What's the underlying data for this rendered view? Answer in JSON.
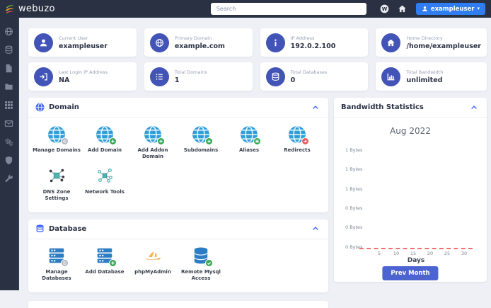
{
  "topbar": {
    "logo_text": "webuzo",
    "search": {
      "placeholder": "Search"
    },
    "user_button": {
      "label": "exampleuser"
    }
  },
  "sidebar": {
    "items": [
      {
        "id": "domains",
        "icon": "globe"
      },
      {
        "id": "databases",
        "icon": "database"
      },
      {
        "id": "files",
        "icon": "file"
      },
      {
        "id": "ftp",
        "icon": "folder"
      },
      {
        "id": "apps",
        "icon": "grid"
      },
      {
        "id": "email",
        "icon": "mail"
      },
      {
        "id": "services",
        "icon": "gears"
      },
      {
        "id": "security",
        "icon": "shield"
      },
      {
        "id": "tools",
        "icon": "wrench"
      }
    ]
  },
  "stats": {
    "cards": [
      {
        "icon": "user",
        "label": "Current User",
        "value": "exampleuser"
      },
      {
        "icon": "globe",
        "label": "Primary Domain",
        "value": "example.com"
      },
      {
        "icon": "info",
        "label": "IP Address",
        "value": "192.0.2.100"
      },
      {
        "icon": "home",
        "label": "Home Directory",
        "value": "/home/exampleuser"
      },
      {
        "icon": "signin",
        "label": "Last Login IP Address",
        "value": "NA"
      },
      {
        "icon": "list",
        "label": "Total Domains",
        "value": "1"
      },
      {
        "icon": "database",
        "label": "Total Databases",
        "value": "0"
      },
      {
        "icon": "chart",
        "label": "Total Bandwidth",
        "value": "unlimited"
      }
    ]
  },
  "panels": {
    "domain": {
      "title": "Domain",
      "items": [
        {
          "label": "Manage Domains",
          "icon": "globe-app",
          "badge": "gear"
        },
        {
          "label": "Add Domain",
          "icon": "globe-app",
          "badge": "plus"
        },
        {
          "label": "Add Addon Domain",
          "icon": "globe-app",
          "badge": "plus"
        },
        {
          "label": "Subdomains",
          "icon": "globe-app",
          "badge": "plus"
        },
        {
          "label": "Aliases",
          "icon": "globe-app",
          "badge": "list"
        },
        {
          "label": "Redirects",
          "icon": "globe-app",
          "badge": "arrow"
        },
        {
          "label": "DNS Zone Settings",
          "icon": "dns-network"
        },
        {
          "label": "Network Tools",
          "icon": "network-tools"
        }
      ]
    },
    "database": {
      "title": "Database",
      "items": [
        {
          "label": "Manage Databases",
          "icon": "servers",
          "badge": "gear"
        },
        {
          "label": "Add Database",
          "icon": "servers",
          "badge": "plus"
        },
        {
          "label": "phpMyAdmin",
          "icon": "phpmyadmin"
        },
        {
          "label": "Remote Mysql Access",
          "icon": "db-stack",
          "badge": "check"
        }
      ]
    },
    "bandwidth": {
      "title": "Bandwidth Statistics",
      "prev_button": "Prev Month"
    }
  },
  "chart_data": {
    "type": "line",
    "title": "Aug 2022",
    "xlabel": "Days",
    "x_ticks": [
      5,
      10,
      15,
      20,
      25,
      30
    ],
    "x_range": [
      1,
      31
    ],
    "y_tick_labels": [
      "1 Bytes",
      "1 Bytes",
      "1 Bytes",
      "0 Bytes",
      "0 Bytes",
      "0 Bytes"
    ],
    "series": [
      {
        "name": "Bandwidth",
        "x": [
          1,
          2,
          3,
          4,
          5,
          6,
          7,
          8,
          9,
          10,
          11,
          12,
          13,
          14,
          15,
          16,
          17,
          18,
          19,
          20,
          21,
          22,
          23,
          24,
          25,
          26,
          27,
          28,
          29,
          30,
          31
        ],
        "y": [
          0,
          0,
          0,
          0,
          0,
          0,
          0,
          0,
          0,
          0,
          0,
          0,
          0,
          0,
          0,
          0,
          0,
          0,
          0,
          0,
          0,
          0,
          0,
          0,
          0,
          0,
          0,
          0,
          0,
          0,
          0
        ]
      }
    ],
    "grid": false,
    "legend": false,
    "zero_line_style": "dashed"
  },
  "colors": {
    "topbar_bg": "#2a3142",
    "accent_blue": "#2f7df0",
    "icon_indigo": "#4254b5",
    "button_indigo": "#4c63d2",
    "header_icon_blue": "#4a6cf7",
    "app_globe_blue": "#2e9ed8",
    "zero_line_red": "#f07070",
    "page_bg": "#eef0f6"
  }
}
